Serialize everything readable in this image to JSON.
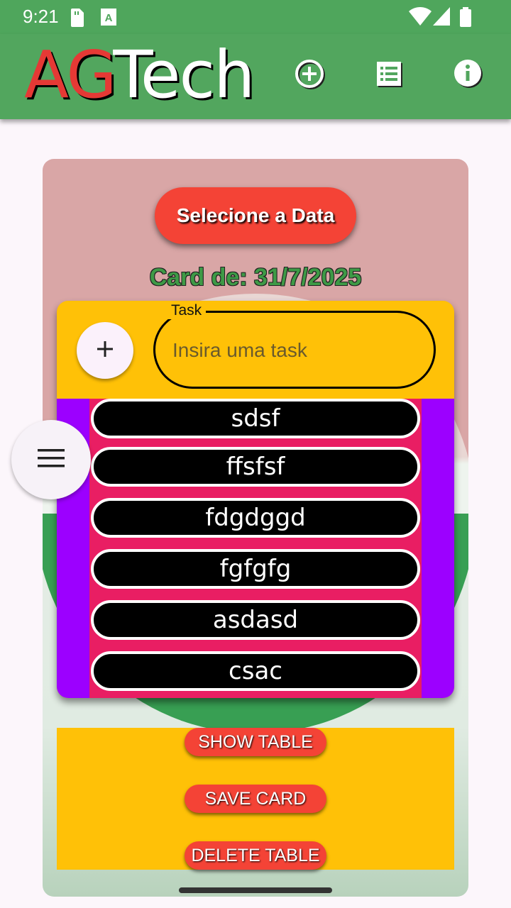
{
  "status_bar": {
    "time": "9:21"
  },
  "app_bar": {
    "logo_part1": "AG",
    "logo_part2": "Tech",
    "actions": [
      "add-circle-icon",
      "list-icon",
      "info-icon"
    ]
  },
  "card": {
    "date_button_label": "Selecione a Data",
    "date_text": "Card de: 31/7/2025"
  },
  "task_form": {
    "legend": "Task",
    "placeholder": "Insira uma task"
  },
  "tasks": [
    "sdsf",
    "ffsfsf",
    "fdgdggd",
    "fgfgfg",
    "asdasd",
    "csac"
  ],
  "actions": {
    "show_table": "SHOW TABLE",
    "save_card": "SAVE CARD",
    "delete_table": "DELETE TABLE"
  },
  "colors": {
    "app_bar": "#52a65e",
    "primary_button": "#f44336",
    "panel": "#ffc107",
    "list_outer": "#9c00ff",
    "list_inner": "#e91e63"
  }
}
